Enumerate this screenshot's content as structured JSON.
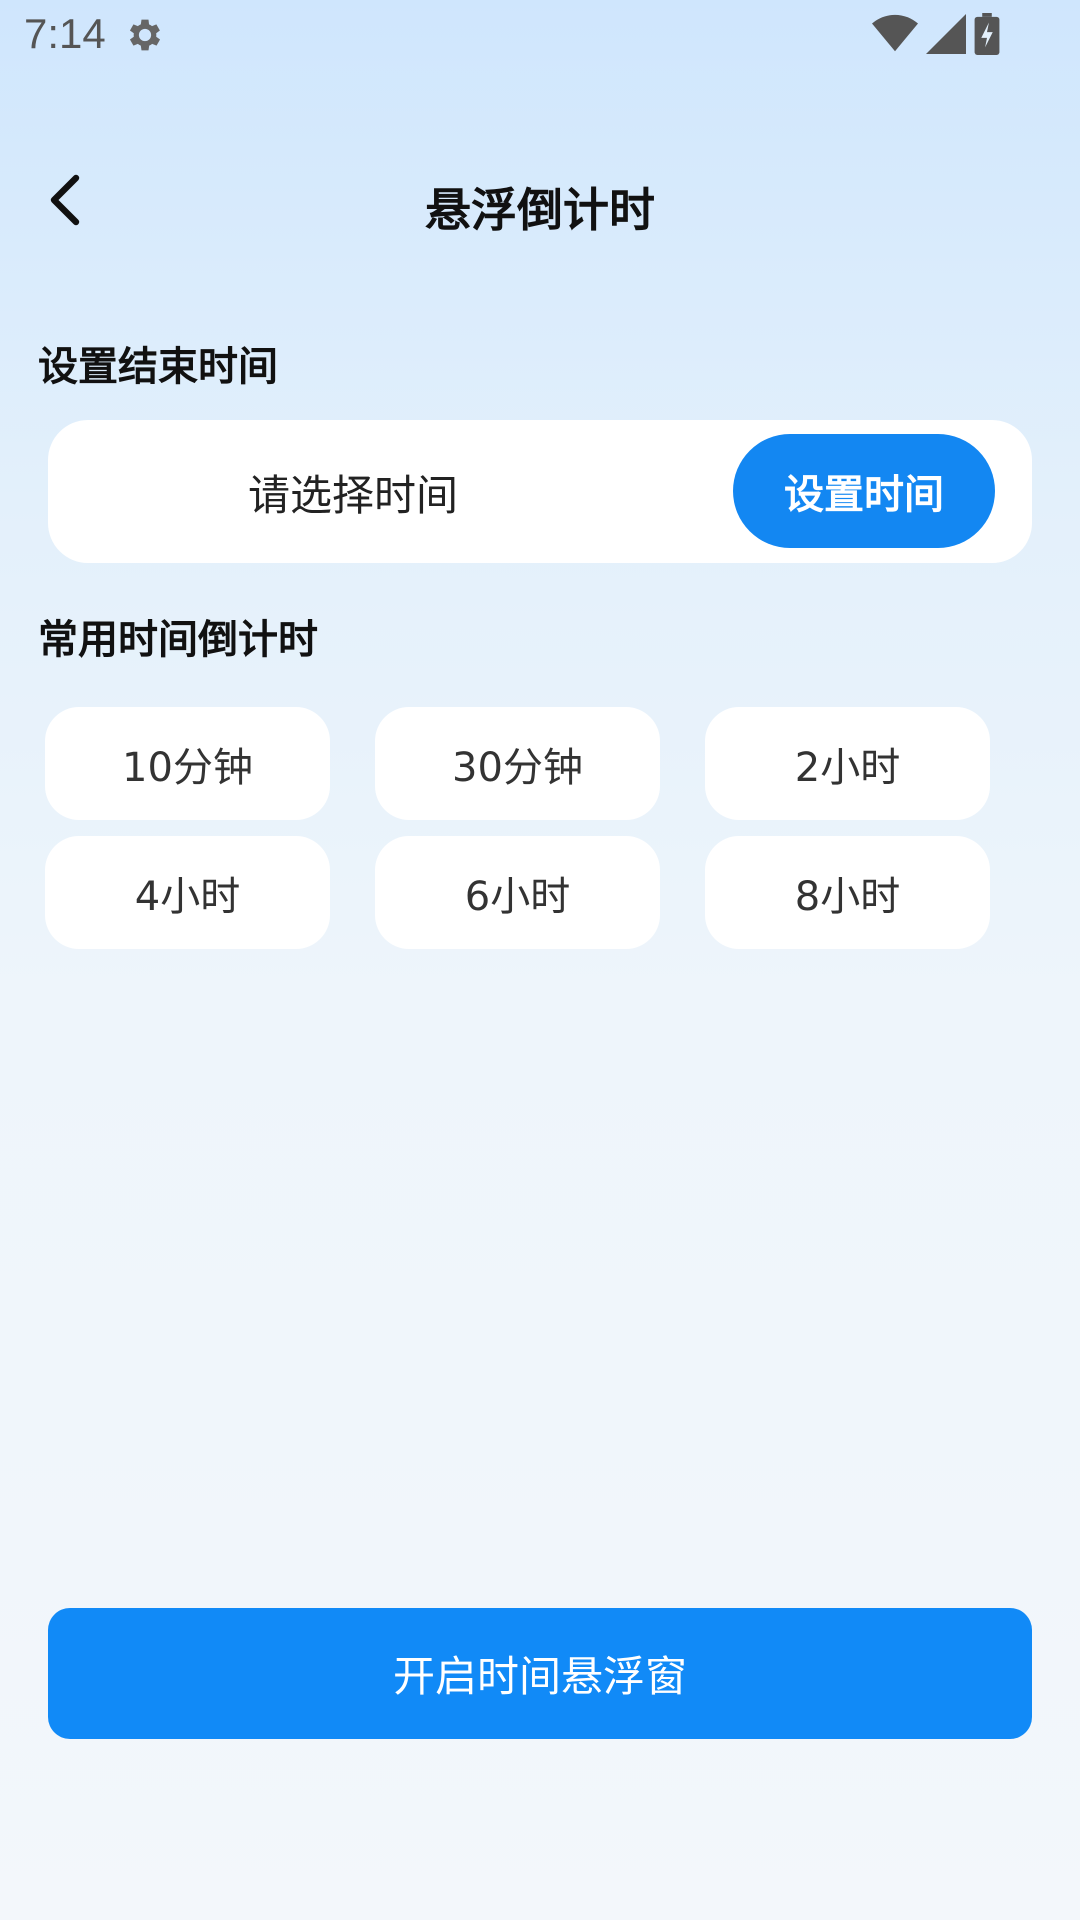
{
  "status_bar": {
    "time": "7:14",
    "icons": [
      "settings-gear-icon",
      "wifi-icon",
      "cellular-signal-icon",
      "battery-charging-icon"
    ]
  },
  "header": {
    "back_icon": "chevron-left-icon",
    "title": "悬浮倒计时"
  },
  "end_time_section": {
    "title": "设置结束时间",
    "placeholder": "请选择时间",
    "button_label": "设置时间"
  },
  "presets_section": {
    "title": "常用时间倒计时",
    "items": [
      {
        "label": "10分钟"
      },
      {
        "label": "30分钟"
      },
      {
        "label": "2小时"
      },
      {
        "label": "4小时"
      },
      {
        "label": "6小时"
      },
      {
        "label": "8小时"
      }
    ]
  },
  "primary_button": {
    "label": "开启时间悬浮窗"
  },
  "colors": {
    "accent": "#1387f2",
    "background_top": "#cfe6fd",
    "background_bottom": "#f3f7fb",
    "card": "#ffffff"
  }
}
